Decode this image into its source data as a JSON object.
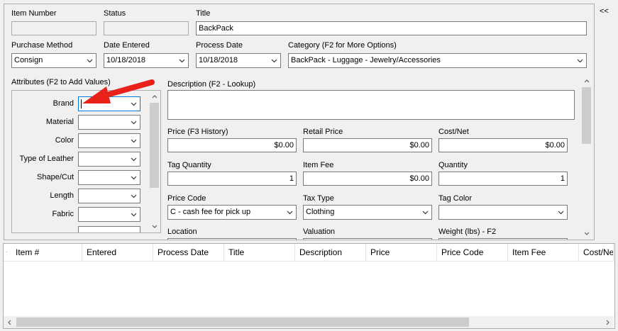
{
  "collapse_button": "<<",
  "header": {
    "item_number": {
      "label": "Item Number",
      "value": ""
    },
    "status": {
      "label": "Status",
      "value": ""
    },
    "title": {
      "label": "Title",
      "value": "BackPack"
    },
    "purchase_method": {
      "label": "Purchase Method",
      "value": "Consign"
    },
    "date_entered": {
      "label": "Date Entered",
      "value": "10/18/2018"
    },
    "process_date": {
      "label": "Process Date",
      "value": "10/18/2018"
    },
    "category": {
      "label": "Category (F2 for More Options)",
      "value": "BackPack - Luggage - Jewelry/Accessories"
    }
  },
  "attributes": {
    "title": "Attributes (F2 to Add Values)",
    "items": [
      {
        "label": "Brand",
        "value": ""
      },
      {
        "label": "Material",
        "value": ""
      },
      {
        "label": "Color",
        "value": ""
      },
      {
        "label": "Type of Leather",
        "value": ""
      },
      {
        "label": "Shape/Cut",
        "value": ""
      },
      {
        "label": "Length",
        "value": ""
      },
      {
        "label": "Fabric",
        "value": ""
      }
    ]
  },
  "details": {
    "description": {
      "label": "Description (F2 - Lookup)",
      "value": ""
    },
    "price": {
      "label": "Price (F3 History)",
      "value": "$0.00"
    },
    "retail_price": {
      "label": "Retail Price",
      "value": "$0.00"
    },
    "cost_net": {
      "label": "Cost/Net",
      "value": "$0.00"
    },
    "tag_quantity": {
      "label": "Tag Quantity",
      "value": "1"
    },
    "item_fee": {
      "label": "Item Fee",
      "value": "$0.00"
    },
    "quantity": {
      "label": "Quantity",
      "value": "1"
    },
    "price_code": {
      "label": "Price Code",
      "value": "C - cash fee for pick up"
    },
    "tax_type": {
      "label": "Tax Type",
      "value": "Clothing"
    },
    "tag_color": {
      "label": "Tag Color",
      "value": ""
    },
    "location": {
      "label": "Location"
    },
    "valuation": {
      "label": "Valuation"
    },
    "weight": {
      "label": "Weight (lbs) - F2"
    }
  },
  "grid": {
    "columns": [
      "Item #",
      "Entered",
      "Process Date",
      "Title",
      "Description",
      "Price",
      "Price Code",
      "Item Fee",
      "Cost/Net"
    ]
  },
  "colors": {
    "annotation_arrow": "#e8211b",
    "focus": "#0078d7"
  }
}
